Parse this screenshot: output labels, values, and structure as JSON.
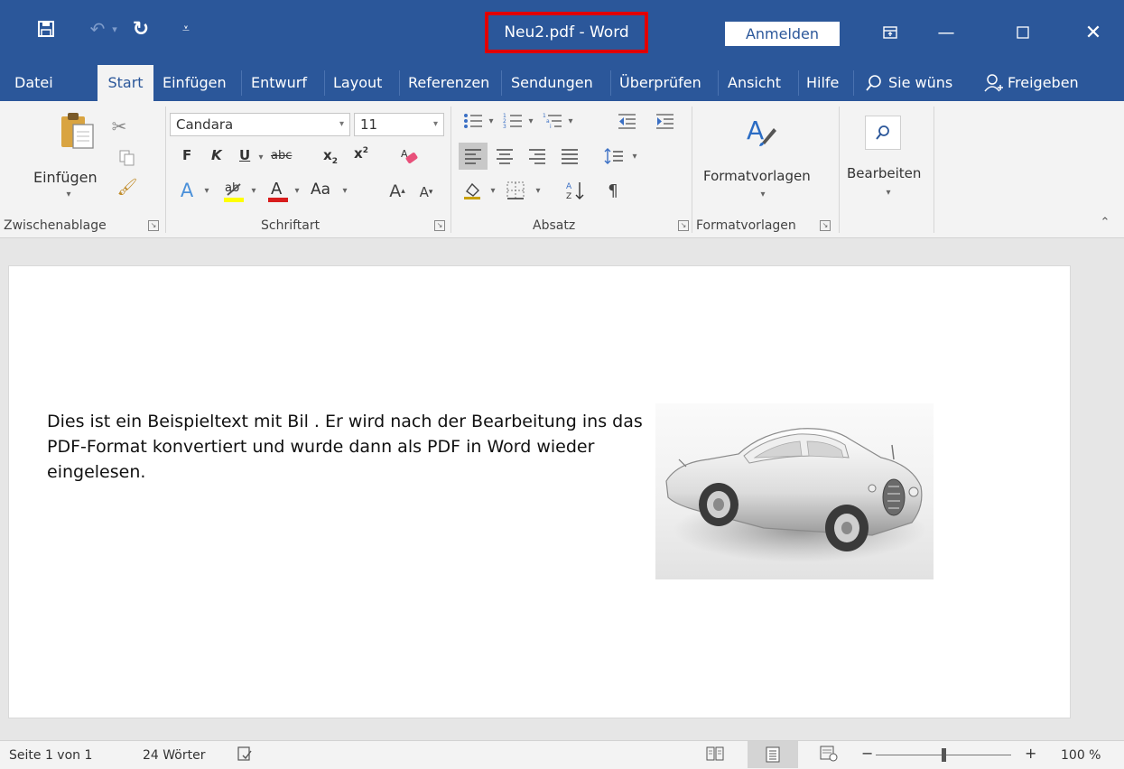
{
  "window": {
    "title": "Neu2.pdf  -  Word",
    "signin": "Anmelden",
    "title_highlight_color": "#e00000",
    "brand_color": "#2b579a"
  },
  "tabs": [
    "Datei",
    "Start",
    "Einfügen",
    "Entwurf",
    "Layout",
    "Referenzen",
    "Sendungen",
    "Überprüfen",
    "Ansicht",
    "Hilfe"
  ],
  "tell_me": "Sie wüns",
  "share": "Freigeben",
  "ribbon": {
    "clipboard": {
      "label": "Zwischenablage",
      "paste": "Einfügen"
    },
    "font": {
      "label": "Schriftart",
      "name": "Candara",
      "size": "11",
      "bold": "F",
      "italic": "K",
      "underline": "U",
      "strike": "abc",
      "change_case": "Aa"
    },
    "paragraph": {
      "label": "Absatz"
    },
    "styles": {
      "label": "Formatvorlagen",
      "button": "Formatvorlagen"
    },
    "editing": {
      "button": "Bearbeiten"
    }
  },
  "document": {
    "text": "Dies ist ein Beispieltext mit Bil   . Er wird nach der Bearbeitung ins das PDF-Format konvertiert und wurde dann als PDF in Word wieder eingelesen."
  },
  "status": {
    "page": "Seite 1 von 1",
    "words": "24 Wörter",
    "zoom": "100 %",
    "zoom_fraction": 0.5
  },
  "icons": [
    "save-icon",
    "undo-icon",
    "redo-icon",
    "customize-qat-icon",
    "ribbon-display-icon",
    "minimize-icon",
    "maximize-icon",
    "close-icon",
    "search-icon",
    "share-person-icon",
    "paste-icon",
    "cut-icon",
    "copy-icon",
    "format-painter-icon",
    "styles-icon",
    "find-icon",
    "collapse-ribbon-icon",
    "proofing-icon",
    "read-mode-icon",
    "print-layout-icon",
    "web-layout-icon"
  ]
}
